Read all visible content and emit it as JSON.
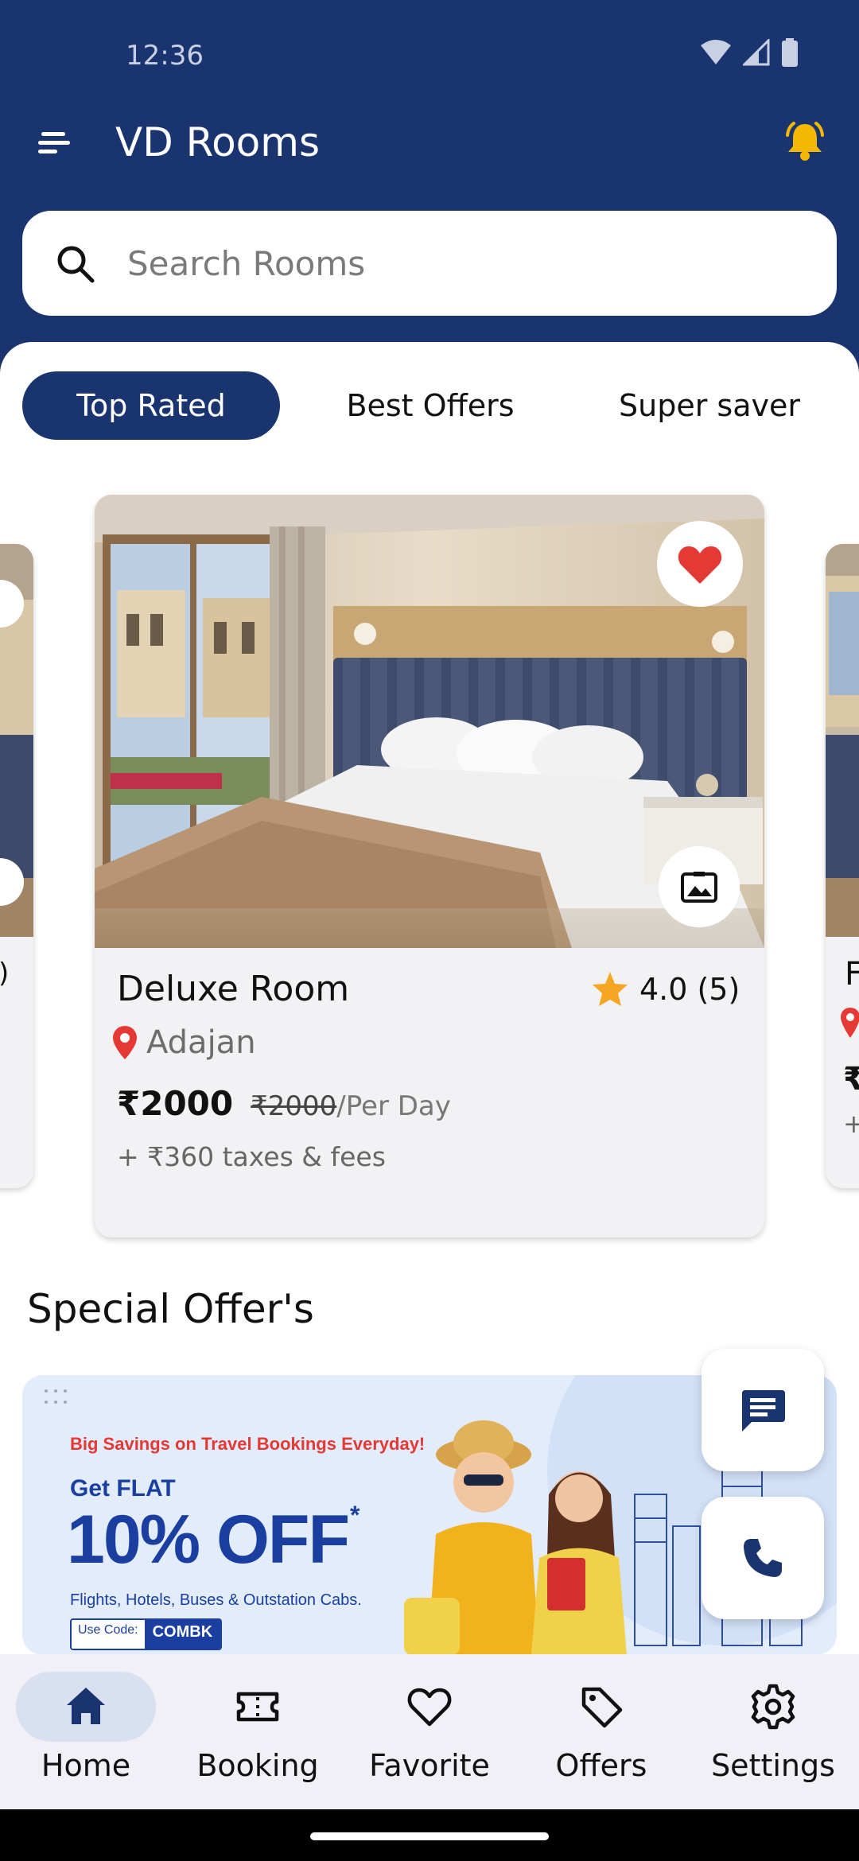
{
  "status_bar": {
    "time": "12:36"
  },
  "app": {
    "title": "VD Rooms"
  },
  "search": {
    "placeholder": "Search Rooms"
  },
  "tabs": [
    {
      "label": "Top Rated",
      "active": true
    },
    {
      "label": "Best Offers",
      "active": false
    },
    {
      "label": "Super saver",
      "active": false
    }
  ],
  "featured_room": {
    "name": "Deluxe Room",
    "rating": "4.0",
    "reviews": "(5)",
    "location": "Adajan",
    "price": "₹2000",
    "old_price": "₹2000",
    "price_unit": "/Per Day",
    "taxes": "+ ₹360 taxes & fees",
    "favorited": true
  },
  "partial_left_card": {
    "rating_tail": ")"
  },
  "partial_right_card": {
    "name_head": "F",
    "price_head": "₹",
    "taxes_head": "+"
  },
  "special_offers": {
    "title": "Special Offer's",
    "banner": {
      "tagline": "Big Savings on Travel Bookings Everyday!",
      "headline": "Get FLAT",
      "discount": "10% OFF",
      "asterisk": "*",
      "subtext": "Flights, Hotels, Buses & Outstation Cabs.",
      "code_label": "Use Code:",
      "code": "COMBK"
    }
  },
  "fabs": [
    {
      "icon": "chat-icon"
    },
    {
      "icon": "phone-icon"
    }
  ],
  "bottom_nav": [
    {
      "label": "Home",
      "icon": "home-icon",
      "active": true
    },
    {
      "label": "Booking",
      "icon": "ticket-icon",
      "active": false
    },
    {
      "label": "Favorite",
      "icon": "heart-outline-icon",
      "active": false
    },
    {
      "label": "Offers",
      "icon": "tag-icon",
      "active": false
    },
    {
      "label": "Settings",
      "icon": "gear-icon",
      "active": false
    }
  ],
  "colors": {
    "primary": "#1a3470",
    "accent_bell": "#f5b800",
    "favorite": "#e53935",
    "star": "#f5a623",
    "location_pin": "#e53935",
    "nav_active_pill": "#d9e0f1"
  }
}
